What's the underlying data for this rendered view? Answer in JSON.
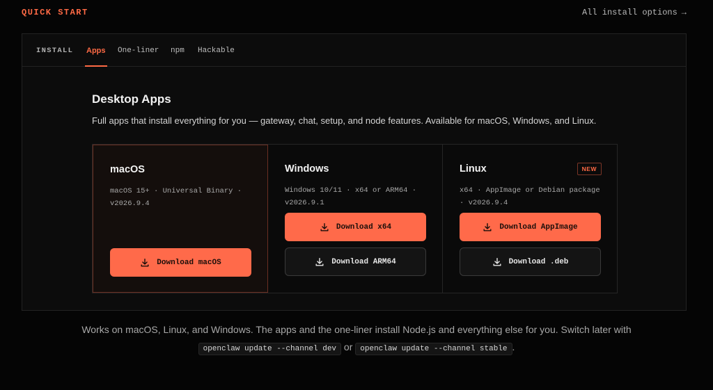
{
  "header": {
    "section_title": "QUICK START",
    "all_options_label": "All install options",
    "arrow": "→"
  },
  "tabs": {
    "label": "INSTALL",
    "items": [
      {
        "label": "Apps",
        "active": true
      },
      {
        "label": "One-liner",
        "active": false
      },
      {
        "label": "npm",
        "active": false
      },
      {
        "label": "Hackable",
        "active": false
      }
    ]
  },
  "content": {
    "title": "Desktop Apps",
    "description": "Full apps that install everything for you — gateway, chat, setup, and node features. Available for macOS, Windows, and Linux."
  },
  "cards": [
    {
      "name": "macOS",
      "meta": "macOS 15+ · Universal Binary · v2026.9.4",
      "primary_label": "Download macOS",
      "selected": true
    },
    {
      "name": "Windows",
      "meta": "Windows 10/11 · x64 or ARM64 · v2026.9.1",
      "primary_label": "Download x64",
      "secondary_label": "Download ARM64"
    },
    {
      "name": "Linux",
      "badge": "NEW",
      "meta": "x64 · AppImage or Debian package · v2026.9.4",
      "primary_label": "Download AppImage",
      "secondary_label": "Download .deb"
    }
  ],
  "footer": {
    "text": "Works on macOS, Linux, and Windows. The apps and the one-liner install Node.js and everything else for you. Switch later with",
    "code_dev": "openclaw update --channel dev",
    "or": "or",
    "code_stable": "openclaw update --channel stable",
    "period": "."
  },
  "colors": {
    "accent": "#ff6a45",
    "background": "#050505",
    "panel": "#0c0c0c"
  },
  "icons": {
    "download": "download-icon",
    "arrow": "arrow-right-icon"
  }
}
